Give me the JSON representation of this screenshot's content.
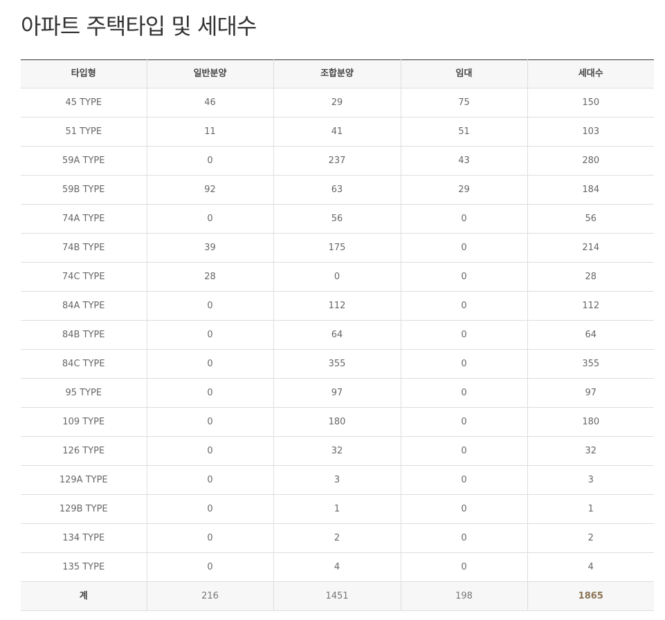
{
  "title": "아파트 주택타입 및 세대수",
  "colors": {
    "accent": "#8a7353",
    "header_bg": "#f7f7f7",
    "border": "#dddddd",
    "top_border": "#333333"
  },
  "table": {
    "headers": [
      "타입형",
      "일반분양",
      "조합분양",
      "임대",
      "세대수"
    ],
    "rows": [
      [
        "45 TYPE",
        "46",
        "29",
        "75",
        "150"
      ],
      [
        "51 TYPE",
        "11",
        "41",
        "51",
        "103"
      ],
      [
        "59A TYPE",
        "0",
        "237",
        "43",
        "280"
      ],
      [
        "59B TYPE",
        "92",
        "63",
        "29",
        "184"
      ],
      [
        "74A TYPE",
        "0",
        "56",
        "0",
        "56"
      ],
      [
        "74B TYPE",
        "39",
        "175",
        "0",
        "214"
      ],
      [
        "74C TYPE",
        "28",
        "0",
        "0",
        "28"
      ],
      [
        "84A TYPE",
        "0",
        "112",
        "0",
        "112"
      ],
      [
        "84B TYPE",
        "0",
        "64",
        "0",
        "64"
      ],
      [
        "84C TYPE",
        "0",
        "355",
        "0",
        "355"
      ],
      [
        "95 TYPE",
        "0",
        "97",
        "0",
        "97"
      ],
      [
        "109 TYPE",
        "0",
        "180",
        "0",
        "180"
      ],
      [
        "126 TYPE",
        "0",
        "32",
        "0",
        "32"
      ],
      [
        "129A TYPE",
        "0",
        "3",
        "0",
        "3"
      ],
      [
        "129B TYPE",
        "0",
        "1",
        "0",
        "1"
      ],
      [
        "134 TYPE",
        "0",
        "2",
        "0",
        "2"
      ],
      [
        "135 TYPE",
        "0",
        "4",
        "0",
        "4"
      ]
    ],
    "total": [
      "계",
      "216",
      "1451",
      "198",
      "1865"
    ]
  }
}
